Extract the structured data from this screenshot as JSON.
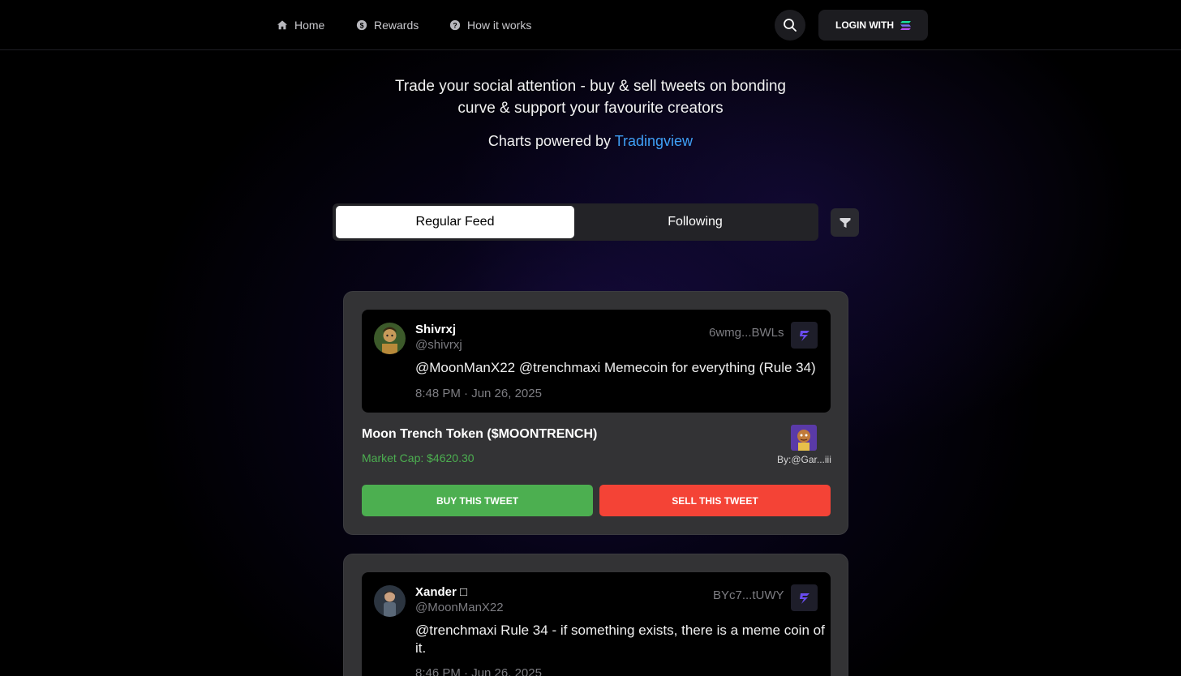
{
  "nav": {
    "items": [
      {
        "label": "Home",
        "icon": "home-icon"
      },
      {
        "label": "Rewards",
        "icon": "dollar-coin-icon"
      },
      {
        "label": "How it works",
        "icon": "question-icon"
      }
    ],
    "search_icon": "search-icon",
    "login_label": "LOGIN WITH",
    "login_icon": "solana-logo-icon"
  },
  "hero": {
    "tagline_line1": "Trade your social attention - buy & sell tweets on bonding",
    "tagline_line2": "curve & support your favourite creators",
    "charts_prefix": "Charts powered by",
    "charts_link": "Tradingview"
  },
  "feed": {
    "tabs": [
      {
        "label": "Regular Feed",
        "active": true
      },
      {
        "label": "Following",
        "active": false
      }
    ],
    "filter_icon": "filter-icon"
  },
  "posts": [
    {
      "author_name": "Shivrxj",
      "author_handle": "@shivrxj",
      "mint_address": "6wmg...BWLs",
      "text": "@MoonManX22 @trenchmaxi Memecoin for everything (Rule 34)",
      "timestamp": "8:48 PM · Jun 26, 2025",
      "token_name": "Moon Trench Token ($MOONTRENCH)",
      "market_cap": "Market Cap: $4620.30",
      "creator": "By:@Gar...iii",
      "buy_label": "BUY THIS TWEET",
      "sell_label": "SELL THIS TWEET"
    },
    {
      "author_name": "Xander □",
      "author_handle": "@MoonManX22",
      "mint_address": "BYc7...tUWY",
      "text_line1": "@trenchmaxi Rule 34 - if something exists, there is a meme coin of",
      "text_line2": "it.",
      "timestamp": "8:46 PM · Jun 26, 2025"
    }
  ],
  "colors": {
    "background": "#000000",
    "accent_link": "#3fa0f6",
    "buy": "#4caf50",
    "sell": "#f44336",
    "market_cap": "#4caf50",
    "card": "#333335"
  }
}
